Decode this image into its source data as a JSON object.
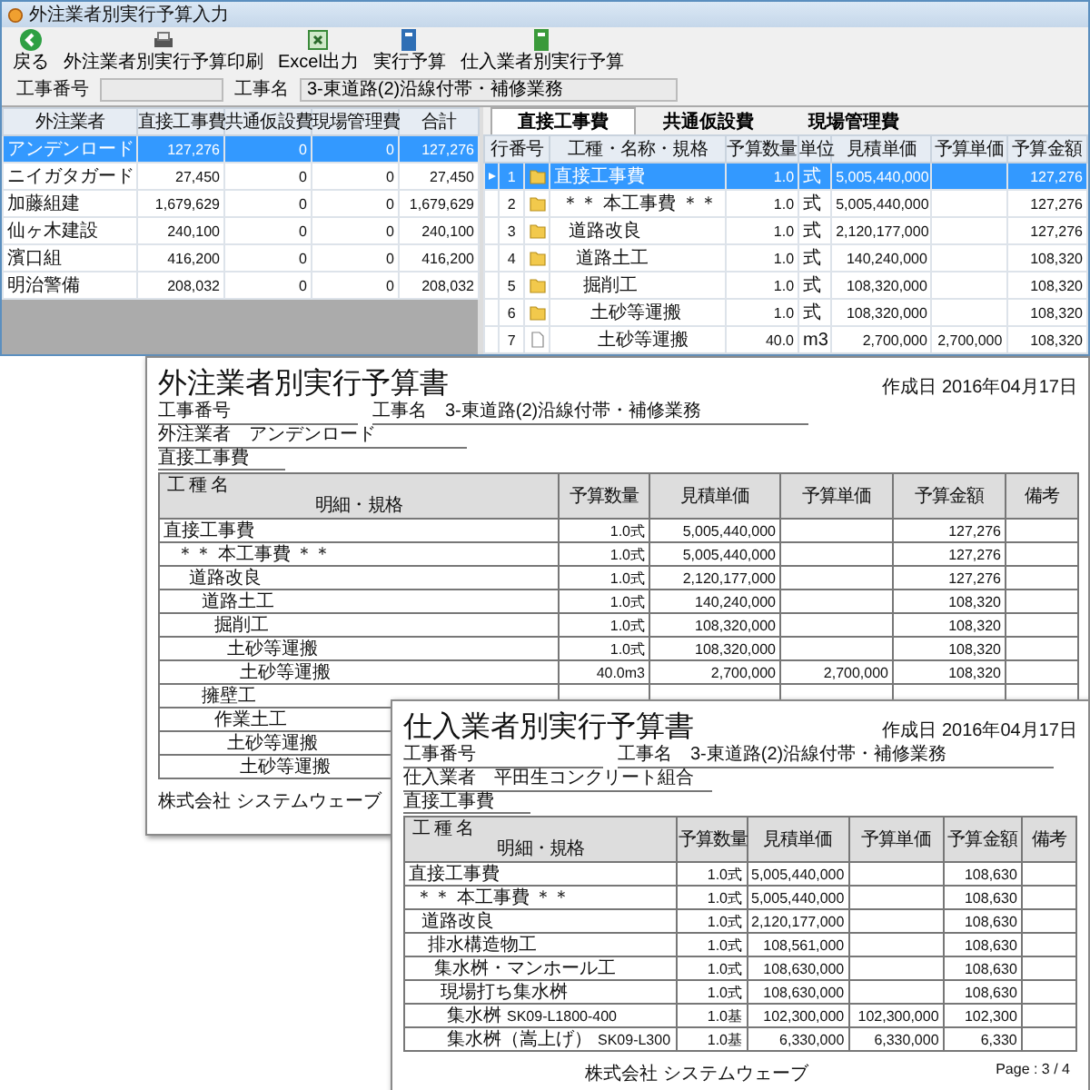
{
  "app": {
    "title": "外注業者別実行予算入力",
    "toolbar": [
      {
        "kind": "back",
        "label": "戻る"
      },
      {
        "kind": "print",
        "label": "外注業者別実行予算印刷"
      },
      {
        "kind": "excel",
        "label": "Excel出力"
      },
      {
        "kind": "budget",
        "label": "実行予算"
      },
      {
        "kind": "supplier",
        "label": "仕入業者別実行予算"
      }
    ],
    "fields": [
      {
        "label": "工事番号"
      },
      {
        "label": "工事名",
        "value": "3-東道路(2)沿線付帯・補修業務"
      }
    ],
    "vendors": {
      "columns": [
        "外注業者",
        "直接工事費",
        "共通仮設費",
        "現場管理費",
        "合計"
      ],
      "rows": [
        {
          "cells": [
            "アンデンロード",
            "127,276",
            "0",
            "0",
            "127,276"
          ],
          "selected": true
        },
        {
          "cells": [
            "ニイガタガード",
            "27,450",
            "0",
            "0",
            "27,450"
          ],
          "selected": false
        },
        {
          "cells": [
            "加藤組建",
            "1,679,629",
            "0",
            "0",
            "1,679,629"
          ],
          "selected": false
        },
        {
          "cells": [
            "仙ヶ木建設",
            "240,100",
            "0",
            "0",
            "240,100"
          ],
          "selected": false
        },
        {
          "cells": [
            "濱口組",
            "416,200",
            "0",
            "0",
            "416,200"
          ],
          "selected": false
        },
        {
          "cells": [
            "明治警備",
            "208,032",
            "0",
            "0",
            "208,032"
          ],
          "selected": false
        }
      ]
    },
    "tabs": [
      {
        "label": "直接工事費",
        "selected": true
      },
      {
        "label": "共通仮設費",
        "selected": false
      },
      {
        "label": "現場管理費",
        "selected": false
      }
    ],
    "grid": {
      "columns": [
        "行番号",
        "工種・名称・規格",
        "予算数量",
        "単位",
        "見積単価",
        "予算単価",
        "予算金額"
      ],
      "rows": [
        {
          "no": "1",
          "kind": "folder",
          "name": "直接工事費",
          "qty": "1.0",
          "unit": "式",
          "estimate": "5,005,440,000",
          "amount": "127,276",
          "selected": true,
          "children": [
            {
              "no": "2",
              "kind": "folder",
              "name": "＊＊ 本工事費 ＊＊",
              "qty": "1.0",
              "unit": "式",
              "estimate": "5,005,440,000",
              "amount": "127,276",
              "selected": false,
              "children": [
                {
                  "no": "3",
                  "kind": "folder",
                  "name": "道路改良",
                  "qty": "1.0",
                  "unit": "式",
                  "estimate": "2,120,177,000",
                  "amount": "127,276",
                  "selected": false,
                  "children": [
                    {
                      "no": "4",
                      "kind": "folder",
                      "name": "道路土工",
                      "qty": "1.0",
                      "unit": "式",
                      "estimate": "140,240,000",
                      "amount": "108,320",
                      "selected": false,
                      "children": [
                        {
                          "no": "5",
                          "kind": "folder",
                          "name": "掘削工",
                          "qty": "1.0",
                          "unit": "式",
                          "estimate": "108,320,000",
                          "amount": "108,320",
                          "selected": false,
                          "children": [
                            {
                              "no": "6",
                              "kind": "folder",
                              "name": "土砂等運搬",
                              "qty": "1.0",
                              "unit": "式",
                              "estimate": "108,320,000",
                              "amount": "108,320",
                              "selected": false,
                              "children": [
                                {
                                  "no": "7",
                                  "kind": "file",
                                  "name": "土砂等運搬",
                                  "qty": "40.0",
                                  "unit": "m3",
                                  "estimate": "2,700,000",
                                  "budget_price": "2,700,000",
                                  "amount": "108,320",
                                  "selected": false
                                }
                              ]
                            }
                          ]
                        }
                      ]
                    }
                  ]
                }
              ]
            }
          ]
        }
      ]
    }
  },
  "documents": [
    {
      "title": "外注業者別実行予算書",
      "date": "作成日 2016年04月17日",
      "fields": [
        {
          "label": "工事番号"
        },
        {
          "label": "工事名",
          "value": "3-東道路(2)沿線付帯・補修業務"
        }
      ],
      "party": {
        "label": "外注業者",
        "value": "アンデンロード"
      },
      "section": "直接工事費",
      "columns": [
        "工 種 名",
        "明細・規格",
        "予算数量",
        "見積単価",
        "予算単価",
        "予算金額",
        "備考"
      ],
      "rows": [
        {
          "name": "直接工事費",
          "qty": "1.0式",
          "estimate": "5,005,440,000",
          "amount": "127,276",
          "children": [
            {
              "name": "＊＊ 本工事費 ＊＊",
              "qty": "1.0式",
              "estimate": "5,005,440,000",
              "amount": "127,276",
              "children": [
                {
                  "name": "道路改良",
                  "qty": "1.0式",
                  "estimate": "2,120,177,000",
                  "amount": "127,276",
                  "children": [
                    {
                      "name": "道路土工",
                      "qty": "1.0式",
                      "estimate": "140,240,000",
                      "amount": "108,320",
                      "children": [
                        {
                          "name": "掘削工",
                          "qty": "1.0式",
                          "estimate": "108,320,000",
                          "amount": "108,320",
                          "children": [
                            {
                              "name": "土砂等運搬",
                              "qty": "1.0式",
                              "estimate": "108,320,000",
                              "amount": "108,320",
                              "children": [
                                {
                                  "name": "土砂等運搬",
                                  "qty": "40.0m3",
                                  "estimate": "2,700,000",
                                  "budget_price": "2,700,000",
                                  "amount": "108,320"
                                }
                              ]
                            }
                          ]
                        }
                      ]
                    },
                    {
                      "name": "擁壁工",
                      "children": [
                        {
                          "name": "作業土工",
                          "children": [
                            {
                              "name": "土砂等運搬",
                              "children": [
                                {
                                  "name": "土砂等運搬"
                                }
                              ]
                            }
                          ]
                        }
                      ]
                    }
                  ]
                }
              ]
            }
          ]
        }
      ],
      "footer": "株式会社 システムウェーブ"
    },
    {
      "title": "仕入業者別実行予算書",
      "date": "作成日 2016年04月17日",
      "fields": [
        {
          "label": "工事番号"
        },
        {
          "label": "工事名",
          "value": "3-東道路(2)沿線付帯・補修業務"
        }
      ],
      "party": {
        "label": "仕入業者",
        "value": "平田生コンクリート組合"
      },
      "section": "直接工事費",
      "columns": [
        "工 種 名",
        "明細・規格",
        "予算数量",
        "見積単価",
        "予算単価",
        "予算金額",
        "備考"
      ],
      "rows": [
        {
          "name": "直接工事費",
          "qty": "1.0式",
          "estimate": "5,005,440,000",
          "amount": "108,630",
          "children": [
            {
              "name": "＊＊ 本工事費 ＊＊",
              "qty": "1.0式",
              "estimate": "5,005,440,000",
              "amount": "108,630",
              "children": [
                {
                  "name": "道路改良",
                  "qty": "1.0式",
                  "estimate": "2,120,177,000",
                  "amount": "108,630",
                  "children": [
                    {
                      "name": "排水構造物工",
                      "qty": "1.0式",
                      "estimate": "108,561,000",
                      "amount": "108,630",
                      "children": [
                        {
                          "name": "集水桝・マンホール工",
                          "qty": "1.0式",
                          "estimate": "108,630,000",
                          "amount": "108,630",
                          "children": [
                            {
                              "name": "現場打ち集水桝",
                              "qty": "1.0式",
                              "estimate": "108,630,000",
                              "amount": "108,630",
                              "children": [
                                {
                                  "name": "集水桝",
                                  "code": "SK09-L1800-400",
                                  "qty": "1.0基",
                                  "estimate": "102,300,000",
                                  "budget_price": "102,300,000",
                                  "amount": "102,300"
                                },
                                {
                                  "name": "集水桝（嵩上げ）",
                                  "code": "SK09-L300",
                                  "qty": "1.0基",
                                  "estimate": "6,330,000",
                                  "budget_price": "6,330,000",
                                  "amount": "6,330"
                                }
                              ]
                            }
                          ]
                        }
                      ]
                    }
                  ]
                }
              ]
            }
          ]
        }
      ],
      "footer": "株式会社 システムウェーブ",
      "page": "Page : 3 / 4"
    }
  ]
}
